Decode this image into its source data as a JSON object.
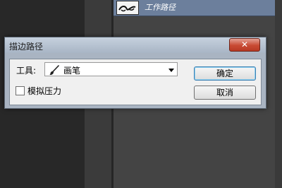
{
  "paths_panel": {
    "selected_path_label": "工作路径"
  },
  "dialog": {
    "title": "描边路径",
    "close_label": "✕",
    "tool_label": "工具:",
    "tool_value": "画笔",
    "tool_icon": "brush-icon",
    "simulate_pressure_label": "模拟压力",
    "simulate_pressure_checked": false,
    "ok_label": "确定",
    "cancel_label": "取消"
  },
  "colors": {
    "selected_row": "#6c7f9c",
    "dialog_frame": "#a9b4c2",
    "close_button": "#c84a33"
  }
}
